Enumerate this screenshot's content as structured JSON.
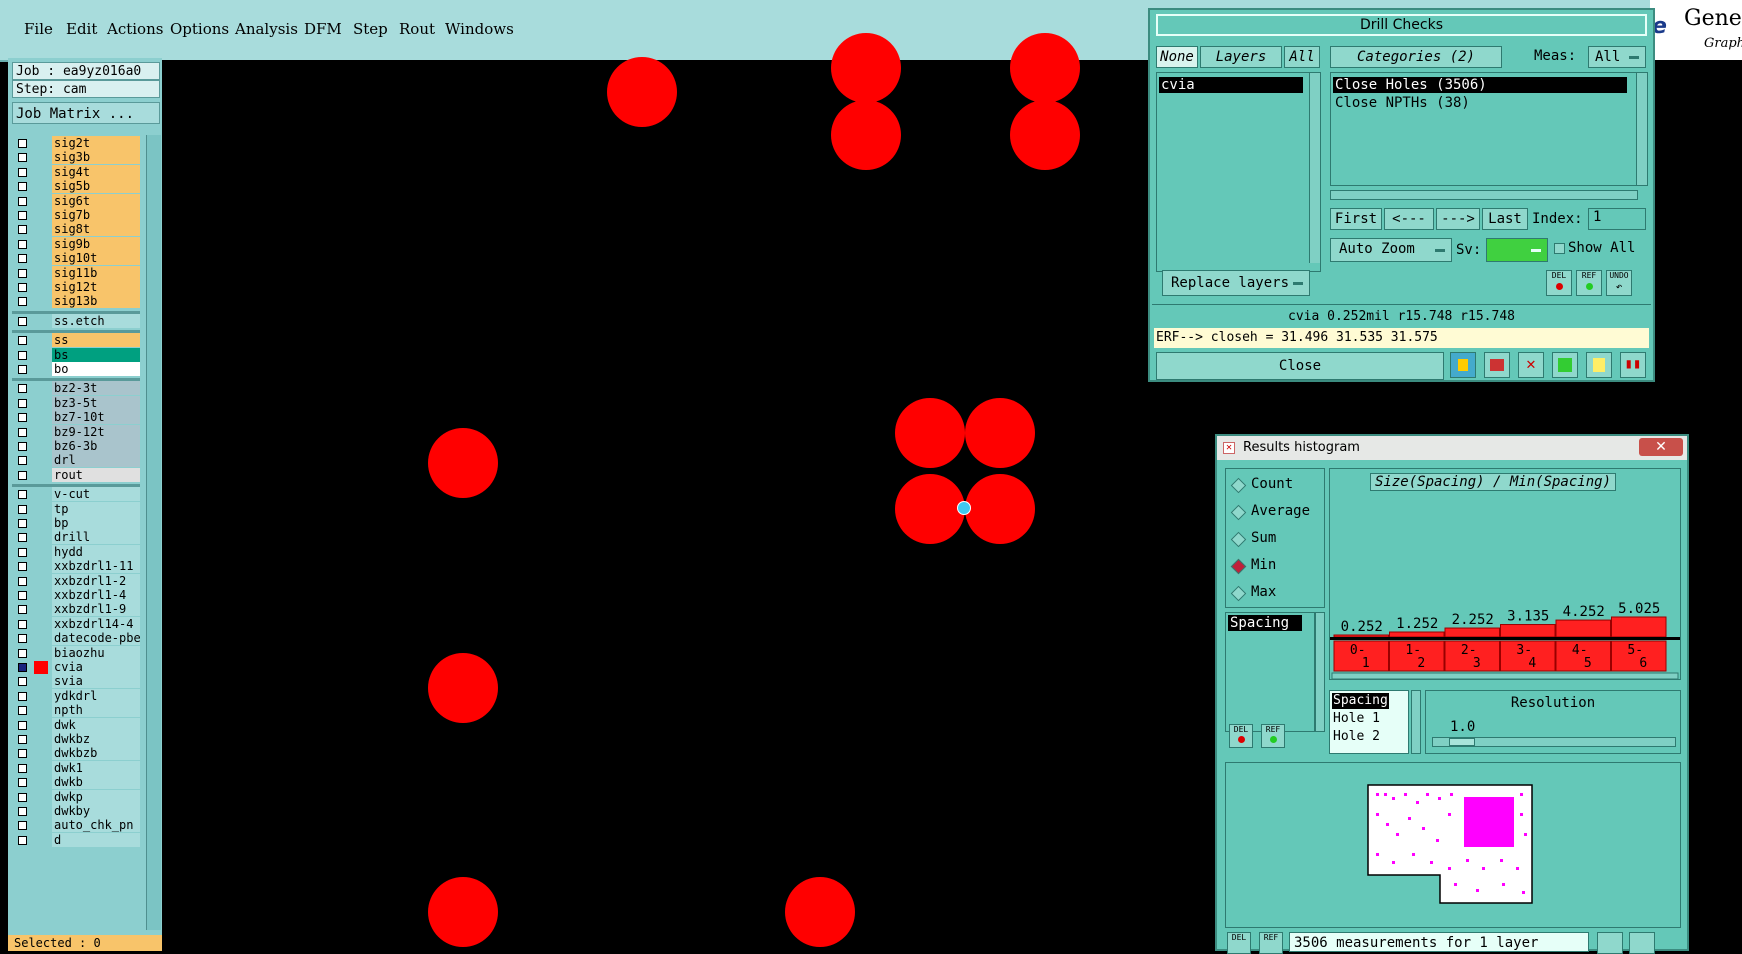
{
  "menubar": {
    "items": [
      "File",
      "Edit",
      "Actions",
      "Options",
      "Analysis",
      "DFM",
      "Step",
      "Rout",
      "Windows"
    ],
    "logo_text": "Genes",
    "logo_sub": "Graph"
  },
  "left": {
    "job": "Job : ea9yz016a0",
    "step": "Step: cam",
    "job_matrix": "Job Matrix ...",
    "layers": [
      {
        "name": "sig2t",
        "color": "#f8c46a"
      },
      {
        "name": "sig3b",
        "color": "#f8c46a"
      },
      {
        "name": "sig4t",
        "color": "#f8c46a"
      },
      {
        "name": "sig5b",
        "color": "#f8c46a"
      },
      {
        "name": "sig6t",
        "color": "#f8c46a"
      },
      {
        "name": "sig7b",
        "color": "#f8c46a"
      },
      {
        "name": "sig8t",
        "color": "#f8c46a"
      },
      {
        "name": "sig9b",
        "color": "#f8c46a"
      },
      {
        "name": "sig10t",
        "color": "#f8c46a"
      },
      {
        "name": "sig11b",
        "color": "#f8c46a"
      },
      {
        "name": "sig12t",
        "color": "#f8c46a"
      },
      {
        "name": "sig13b",
        "color": "#f8c46a"
      },
      {
        "name": "ss.etch",
        "color": "#a8dcdc"
      },
      {
        "name": "ss",
        "color": "#f8c46a"
      },
      {
        "name": "bs",
        "color": "#00a080"
      },
      {
        "name": "bo",
        "color": "#ffffff"
      },
      {
        "name": "bz2-3t",
        "color": "#a9c4cc"
      },
      {
        "name": "bz3-5t",
        "color": "#a9c4cc"
      },
      {
        "name": "bz7-10t",
        "color": "#a9c4cc"
      },
      {
        "name": "bz9-12t",
        "color": "#a9c4cc"
      },
      {
        "name": "bz6-3b",
        "color": "#a9c4cc"
      },
      {
        "name": "drl",
        "color": "#a9c4cc"
      },
      {
        "name": "rout",
        "color": "#e0e0e0"
      },
      {
        "name": "v-cut",
        "color": "#a8dcdc"
      },
      {
        "name": "tp",
        "color": "#a8dcdc"
      },
      {
        "name": "bp",
        "color": "#a8dcdc"
      },
      {
        "name": "drill",
        "color": "#a8dcdc"
      },
      {
        "name": "hydd",
        "color": "#a8dcdc"
      },
      {
        "name": "xxbzdrl1-11",
        "color": "#a8dcdc"
      },
      {
        "name": "xxbzdrl1-2",
        "color": "#a8dcdc"
      },
      {
        "name": "xxbzdrl1-4",
        "color": "#a8dcdc"
      },
      {
        "name": "xxbzdrl1-9",
        "color": "#a8dcdc"
      },
      {
        "name": "xxbzdrl14-4",
        "color": "#a8dcdc"
      },
      {
        "name": "datecode-pbe",
        "color": "#a8dcdc"
      },
      {
        "name": "biaozhu",
        "color": "#a8dcdc"
      },
      {
        "name": "cvia",
        "color": "#a8dcdc"
      },
      {
        "name": "svia",
        "color": "#a8dcdc"
      },
      {
        "name": "ydkdrl",
        "color": "#a8dcdc"
      },
      {
        "name": "npth",
        "color": "#a8dcdc"
      },
      {
        "name": "dwk",
        "color": "#a8dcdc"
      },
      {
        "name": "dwkbz",
        "color": "#a8dcdc"
      },
      {
        "name": "dwkbzb",
        "color": "#a8dcdc"
      },
      {
        "name": "dwk1",
        "color": "#a8dcdc"
      },
      {
        "name": "dwkb",
        "color": "#a8dcdc"
      },
      {
        "name": "dwkp",
        "color": "#a8dcdc"
      },
      {
        "name": "dwkby",
        "color": "#a8dcdc"
      },
      {
        "name": "auto_chk_pn",
        "color": "#a8dcdc"
      },
      {
        "name": "d",
        "color": "#a8dcdc"
      }
    ],
    "selected": "Selected : 0"
  },
  "drill": {
    "title": "Drill Checks",
    "none_btn": "None",
    "layers_btn": "Layers",
    "all_btn": "All",
    "categories_btn": "Categories (2)",
    "meas_label": "Meas:",
    "meas_value": "All",
    "layer_list": [
      "cvia"
    ],
    "categories": [
      "Close Holes (3506)",
      "Close NPTHs (38)"
    ],
    "first": "First",
    "prev": "<---",
    "next": "--->",
    "last": "Last",
    "index_label": "Index:",
    "index_value": "1",
    "auto_zoom": "Auto Zoom",
    "sv_label": "Sv:",
    "show_all": "Show All",
    "replace_layers": "Replace layers",
    "status_line": "cvia 0.252mil   r15.748   r15.748",
    "erf_line": "ERF--> closeh = 31.496 31.535 31.575",
    "close": "Close",
    "del": "DEL",
    "ref": "REF",
    "undo": "UNDO"
  },
  "hist": {
    "title": "Results histogram",
    "options": [
      "Count",
      "Average",
      "Sum",
      "Min",
      "Max"
    ],
    "selected_option": "Min",
    "chart_title": "Size(Spacing) / Min(Spacing)",
    "list_left": [
      "Spacing"
    ],
    "list_bottom": [
      "Spacing",
      "Hole 1",
      "Hole 2"
    ],
    "resolution_label": "Resolution",
    "resolution_value": "1.0",
    "footer": "3506 measurements for 1 layer",
    "del": "DEL",
    "ref": "REF"
  },
  "chart_data": {
    "type": "bar",
    "title": "Size(Spacing) / Min(Spacing)",
    "categories": [
      "0-1",
      "1-2",
      "2-3",
      "3-4",
      "4-5",
      "5-6"
    ],
    "values": [
      0.252,
      1.252,
      2.252,
      3.135,
      4.252,
      5.025
    ],
    "value_labels": [
      "0.252",
      "1.252",
      "2.252",
      "3.135",
      "4.252",
      "5.025"
    ],
    "bucket_labels": [
      [
        "0-",
        "1"
      ],
      [
        "1-",
        "2"
      ],
      [
        "2-",
        "3"
      ],
      [
        "3-",
        "4"
      ],
      [
        "4-",
        "5"
      ],
      [
        "5-",
        "6"
      ]
    ],
    "ylim": [
      0,
      5.025
    ],
    "color": "#ff2020"
  }
}
